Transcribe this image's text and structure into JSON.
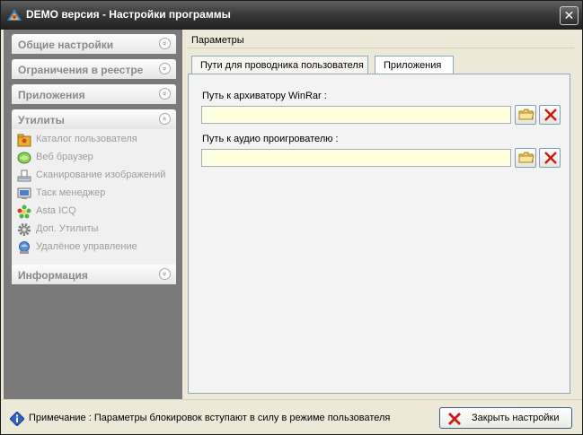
{
  "window": {
    "title": "DEMO версия - Настройки программы",
    "close_symbol": "✕"
  },
  "sidebar": {
    "sections": [
      {
        "label": "Общие настройки",
        "state": "collapsed",
        "chevron": "»"
      },
      {
        "label": "Ограничения в реестре",
        "state": "collapsed",
        "chevron": "»"
      },
      {
        "label": "Приложения",
        "state": "collapsed",
        "chevron": "»"
      },
      {
        "label": "Утилиты",
        "state": "expanded",
        "chevron": "«"
      },
      {
        "label": "Информация",
        "state": "collapsed",
        "chevron": "»"
      }
    ],
    "utilities": [
      {
        "label": "Каталог пользователя",
        "icon": "user-catalog-icon"
      },
      {
        "label": "Веб браузер",
        "icon": "web-browser-icon"
      },
      {
        "label": "Сканирование изображений",
        "icon": "scanner-icon"
      },
      {
        "label": "Таск менеджер",
        "icon": "task-manager-icon"
      },
      {
        "label": "Asta ICQ",
        "icon": "icq-flower-icon"
      },
      {
        "label": "Доп. Утилиты",
        "icon": "gear-icon"
      },
      {
        "label": "Удалёное управление",
        "icon": "remote-control-icon"
      }
    ]
  },
  "main": {
    "section_title": "Параметры",
    "tabs": [
      {
        "label": "Пути для проводника пользователя",
        "active": false
      },
      {
        "label": "Приложения",
        "active": true
      }
    ],
    "fields": [
      {
        "label": "Путь к архиватору WinRar :",
        "value": ""
      },
      {
        "label": "Путь к аудио проигрователю :",
        "value": ""
      }
    ]
  },
  "footer": {
    "note": "Примечание : Параметры блокировок вступают в силу в режиме пользователя",
    "close_button_label": "Закрыть настройки"
  },
  "colors": {
    "titlebar": "#3b3b3b",
    "sidebar_bg": "#7a7a7a",
    "input_bg": "#ffffe1",
    "clear_red": "#cc1a1a"
  }
}
